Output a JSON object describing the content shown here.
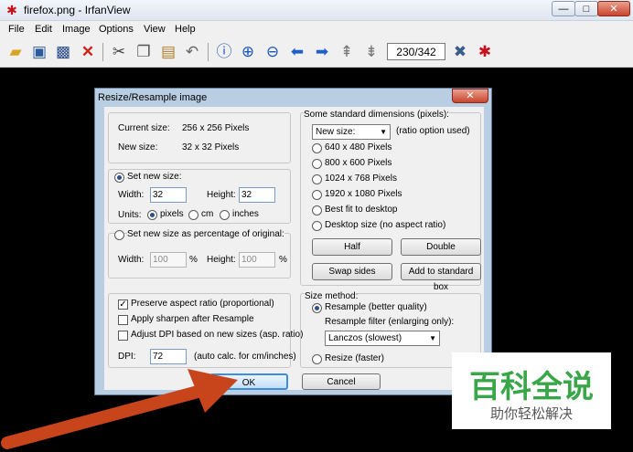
{
  "window": {
    "title": "firefox.png - IrfanView",
    "min": "—",
    "max": "□",
    "close": "✕"
  },
  "menu": [
    "File",
    "Edit",
    "Image",
    "Options",
    "View",
    "Help"
  ],
  "toolbar": {
    "page_counter": "230/342"
  },
  "dialog": {
    "title": "Resize/Resample image",
    "close": "✕",
    "current_size_label": "Current size:",
    "current_size_value": "256  x  256  Pixels",
    "new_size_label": "New size:",
    "new_size_value": "32  x  32  Pixels",
    "set_new_size": "Set new size:",
    "width_label": "Width:",
    "width_value": "32",
    "height_label": "Height:",
    "height_value": "32",
    "units_label": "Units:",
    "units": [
      "pixels",
      "cm",
      "inches"
    ],
    "percent_label": "Set new size as percentage of original:",
    "pct_width_label": "Width:",
    "pct_width_value": "100",
    "pct_height_label": "Height:",
    "pct_height_value": "100",
    "pct_unit": "%",
    "preserve_aspect": "Preserve aspect ratio (proportional)",
    "apply_sharpen": "Apply sharpen after Resample",
    "adjust_dpi": "Adjust DPI based on new sizes (asp. ratio)",
    "dpi_label": "DPI:",
    "dpi_value": "72",
    "dpi_note": "(auto calc. for cm/inches)",
    "standard_dims_label": "Some standard dimensions (pixels):",
    "new_size_combo": "New size:",
    "ratio_note": "(ratio option used)",
    "dims": [
      "640 x 480 Pixels",
      "800 x 600 Pixels",
      "1024 x 768 Pixels",
      "1920 x 1080 Pixels",
      "Best fit to desktop",
      "Desktop size (no aspect ratio)"
    ],
    "half": "Half",
    "double": "Double",
    "swap": "Swap sides",
    "add_standard": "Add to standard box",
    "size_method_label": "Size method:",
    "resample": "Resample (better quality)",
    "filter_label": "Resample filter (enlarging only):",
    "filter_value": "Lanczos (slowest)",
    "resize_faster": "Resize (faster)",
    "ok": "OK",
    "cancel": "Cancel"
  },
  "watermark": {
    "title": "百科全说",
    "subtitle": "助你轻松解决"
  },
  "colors": {
    "canvas": "#000000",
    "dialog_frame": "#b9cde3",
    "arrow": "#c8451c",
    "watermark_green": "#3aa64a"
  }
}
